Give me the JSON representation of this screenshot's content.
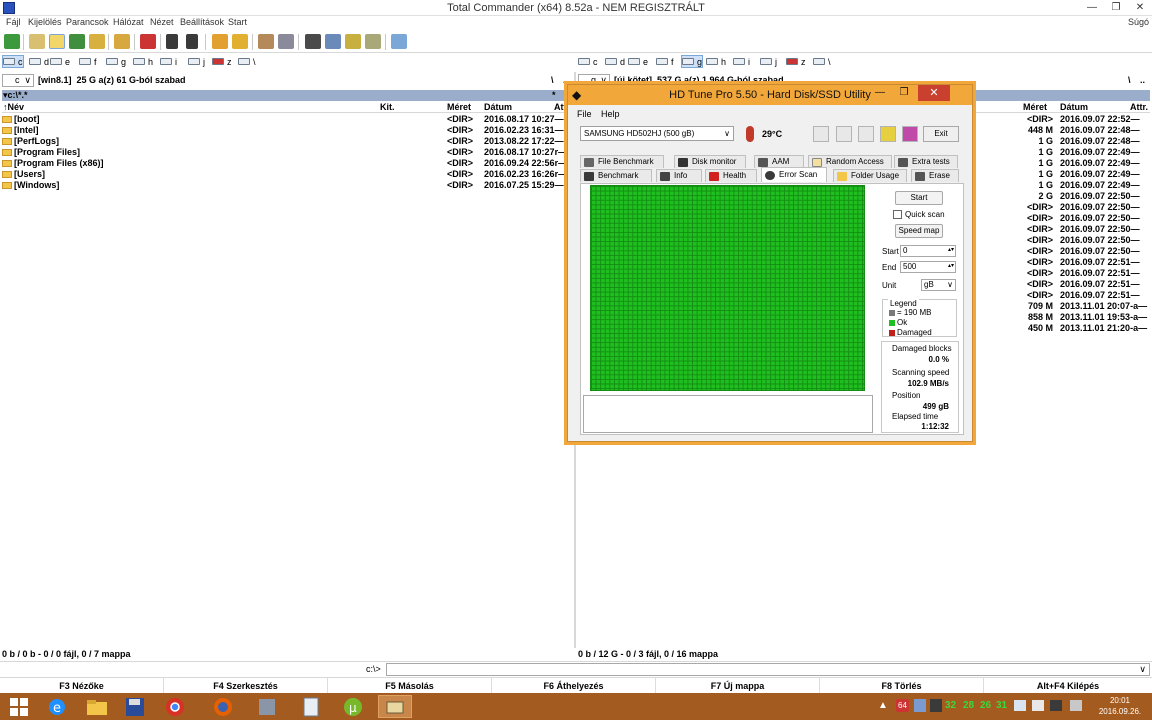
{
  "window": {
    "title": "Total Commander (x64) 8.52a - NEM REGISZTRÁLT",
    "help": "Súgó",
    "minimize": "—",
    "restore": "❐",
    "close": "✕"
  },
  "menu": [
    "Fájl",
    "Kijelölés",
    "Parancsok",
    "Hálózat",
    "Nézet",
    "Beállítások",
    "Start"
  ],
  "drives": [
    "c",
    "d",
    "e",
    "f",
    "g",
    "h",
    "i",
    "j",
    "z",
    "\\"
  ],
  "left_panel": {
    "drive": "c",
    "volume": "[win8.1]",
    "free": "25 G a(z) 61 G-ból szabad",
    "path": "▾c:\\*.*",
    "root": "\\",
    "up": "..",
    "sort_star": "*",
    "sort_dir": "▾",
    "col_name": "↑Név",
    "col_ext": "Kit.",
    "col_size": "Méret",
    "col_date": "Dátum",
    "col_attr": "Attr.",
    "files": [
      {
        "name": "[boot]",
        "size": "<DIR>",
        "date": "2016.08.17 10:27—"
      },
      {
        "name": "[Intel]",
        "size": "<DIR>",
        "date": "2016.02.23 16:31—"
      },
      {
        "name": "[PerfLogs]",
        "size": "<DIR>",
        "date": "2013.08.22 17:22—"
      },
      {
        "name": "[Program Files]",
        "size": "<DIR>",
        "date": "2016.08.17 10:27r—"
      },
      {
        "name": "[Program Files (x86)]",
        "size": "<DIR>",
        "date": "2016.09.24 22:56r—"
      },
      {
        "name": "[Users]",
        "size": "<DIR>",
        "date": "2016.02.23 16:26r—"
      },
      {
        "name": "[Windows]",
        "size": "<DIR>",
        "date": "2016.07.25 15:29—"
      }
    ],
    "status": "0 b / 0 b - 0 / 0 fájl, 0 / 7 mappa"
  },
  "right_panel": {
    "drive": "g",
    "volume": "[új kötet]",
    "free": "537 G a(z) 1 964 G-ból szabad",
    "root": "\\",
    "up": "..",
    "col_size": "Méret",
    "col_date": "Dátum",
    "col_attr": "Attr.",
    "files": [
      {
        "size": "<DIR>",
        "date": "2016.09.07 22:52—"
      },
      {
        "size": "448 M",
        "date": "2016.09.07 22:48—"
      },
      {
        "size": "1 G",
        "date": "2016.09.07 22:48—"
      },
      {
        "size": "1 G",
        "date": "2016.09.07 22:49—"
      },
      {
        "size": "1 G",
        "date": "2016.09.07 22:49—"
      },
      {
        "size": "1 G",
        "date": "2016.09.07 22:49—"
      },
      {
        "size": "1 G",
        "date": "2016.09.07 22:49—"
      },
      {
        "size": "2 G",
        "date": "2016.09.07 22:50—"
      },
      {
        "size": "<DIR>",
        "date": "2016.09.07 22:50—"
      },
      {
        "size": "<DIR>",
        "date": "2016.09.07 22:50—"
      },
      {
        "size": "<DIR>",
        "date": "2016.09.07 22:50—"
      },
      {
        "size": "<DIR>",
        "date": "2016.09.07 22:50—"
      },
      {
        "size": "<DIR>",
        "date": "2016.09.07 22:50—"
      },
      {
        "size": "<DIR>",
        "date": "2016.09.07 22:51—"
      },
      {
        "size": "<DIR>",
        "date": "2016.09.07 22:51—"
      },
      {
        "size": "<DIR>",
        "date": "2016.09.07 22:51—"
      },
      {
        "size": "<DIR>",
        "date": "2016.09.07 22:51—"
      },
      {
        "size": "709 M",
        "date": "2013.11.01 20:07-a—"
      },
      {
        "size": "858 M",
        "date": "2013.11.01 19:53-a—"
      },
      {
        "size": "450 M",
        "date": "2013.11.01 21:20-a—"
      }
    ],
    "status": "0 b / 12 G - 0 / 3 fájl, 0 / 16 mappa"
  },
  "cmd_prompt": "c:\\>",
  "fkeys": [
    "F3 Nézőke",
    "F4 Szerkesztés",
    "F5 Másolás",
    "F6 Áthelyezés",
    "F7 Új mappa",
    "F8 Törlés",
    "Alt+F4 Kilépés"
  ],
  "hdtune": {
    "title": "HD Tune Pro 5.50 - Hard Disk/SSD Utility",
    "menu": [
      "File",
      "Help"
    ],
    "drive": "SAMSUNG HD502HJ (500 gB)",
    "temperature": "29°C",
    "exit": "Exit",
    "tabs_row1": [
      "File Benchmark",
      "Disk monitor",
      "AAM",
      "Random Access",
      "Extra tests"
    ],
    "tabs_row2": [
      "Benchmark",
      "Info",
      "Health",
      "Error Scan",
      "Folder Usage",
      "Erase"
    ],
    "start_btn": "Start",
    "quick_scan": "Quick scan",
    "speed_map": "Speed map",
    "start_label": "Start",
    "start_val": "0",
    "end_label": "End",
    "end_val": "500",
    "unit_label": "Unit",
    "unit_val": "gB",
    "legend_title": "Legend",
    "legend_block": "= 190 MB",
    "legend_ok": "Ok",
    "legend_damaged": "Damaged",
    "damaged_label": "Damaged blocks",
    "damaged_val": "0.0 %",
    "speed_label": "Scanning speed",
    "speed_val": "102.9 MB/s",
    "position_label": "Position",
    "position_val": "499 gB",
    "elapsed_label": "Elapsed time",
    "elapsed_val": "1:12:32",
    "colors": {
      "ok": "#1fbf1f",
      "damaged": "#c0201a",
      "block": "#7a7a7a"
    }
  },
  "tray": {
    "nums": [
      "64",
      "32",
      "28",
      "26",
      "31"
    ],
    "time": "20:01",
    "date": "2016.09.26."
  }
}
